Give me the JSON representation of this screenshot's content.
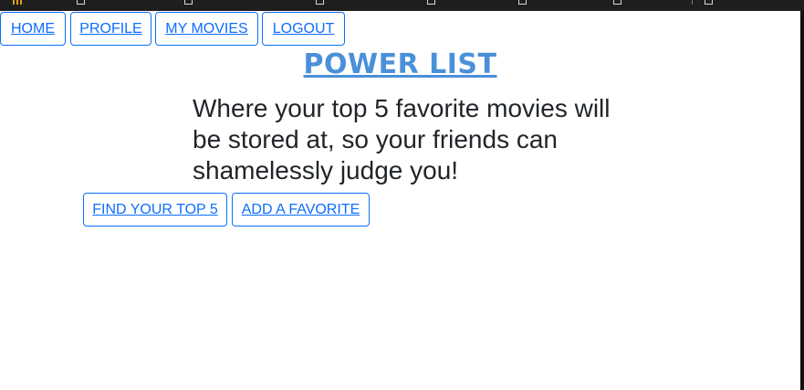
{
  "nav": {
    "home": "HOME",
    "profile": "PROFILE",
    "my_movies": "MY MOVIES",
    "logout": "LOGOUT"
  },
  "title": "POWER LIST",
  "tagline": "Where your top 5 favorite movies will be stored at, so your friends can shamelessly judge you!",
  "actions": {
    "find_top5": "FIND YOUR TOP 5",
    "add_favorite": "ADD A FAVORITE"
  },
  "colors": {
    "button_accent": "#0d6efd",
    "title": "#4a90d9",
    "text": "#212529",
    "background": "#ffffff"
  }
}
